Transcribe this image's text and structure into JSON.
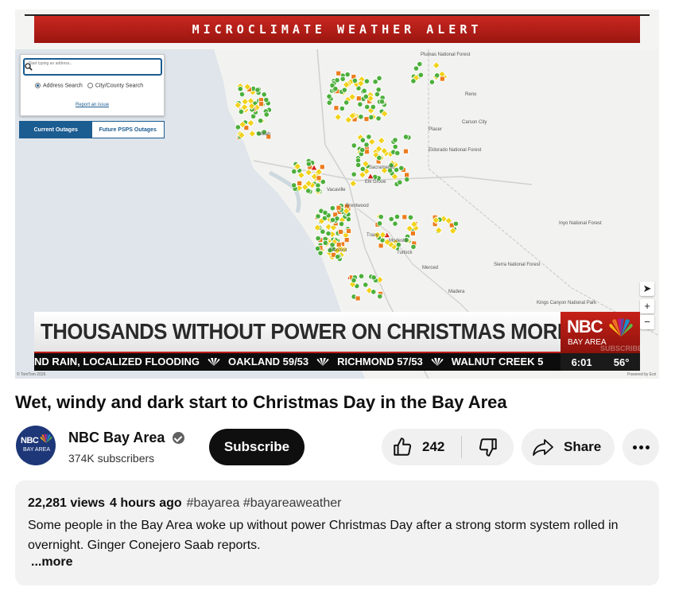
{
  "video": {
    "alert_banner": "MICROCLIMATE WEATHER ALERT",
    "map": {
      "search_placeholder": "Start typing an address...",
      "radio_address": "Address Search",
      "radio_city": "City/County Search",
      "report_link": "Report an issue",
      "tab_current": "Current Outages",
      "tab_future": "Future PSPS Outages",
      "places": [
        "Ukiah",
        "Plumas National Forest",
        "Reno",
        "Carson City",
        "Placer",
        "Eldorado National Forest",
        "Vacaville",
        "Elk Grove",
        "Sacramento",
        "Brentwood",
        "Tracy",
        "Modesto",
        "Turlock",
        "Merced",
        "Fremont",
        "Madera",
        "Sierra National Forest",
        "Kings Canyon National Park",
        "Inyo National Forest"
      ],
      "attribution_left": "© TomTom 2025",
      "attribution_right": "Powered by Esri",
      "marker_colors": {
        "green": "#4caf3c",
        "yellow": "#f2d21a",
        "orange": "#ec7c1e",
        "red": "#d4231a"
      }
    },
    "headline": "THOUSANDS WITHOUT POWER ON CHRISTMAS MORNING",
    "ticker": [
      "ND RAIN, LOCALIZED FLOODING",
      "OAKLAND 59/53",
      "RICHMOND 57/53",
      "WALNUT CREEK 5"
    ],
    "station": {
      "logo": "NBC",
      "sub": "BAY AREA"
    },
    "watermark": "SUBSCRIBE",
    "time": "6:01",
    "temp": "56°",
    "brand_red": "#c62218"
  },
  "title": "Wet, windy and dark start to Christmas Day in the Bay Area",
  "channel": {
    "avatar_line1": "NBC",
    "avatar_line2": "BAY AREA",
    "name": "NBC Bay Area",
    "subscribers": "374K subscribers",
    "subscribe_label": "Subscribe"
  },
  "actions": {
    "likes": "242",
    "share_label": "Share"
  },
  "description": {
    "views": "22,281 views",
    "ago": "4 hours ago",
    "tags": "#bayarea #bayareaweather",
    "text": "Some people in the Bay Area woke up without power Christmas Day after a strong storm system rolled in overnight. Ginger Conejero Saab reports.",
    "more": "...more"
  }
}
